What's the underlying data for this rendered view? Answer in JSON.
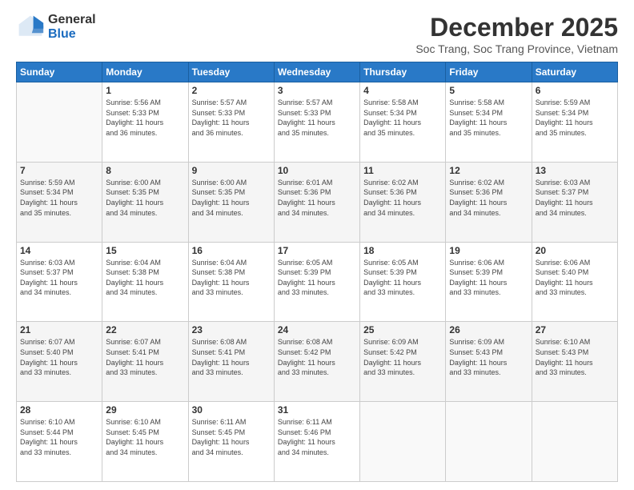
{
  "logo": {
    "general": "General",
    "blue": "Blue"
  },
  "title": "December 2025",
  "location": "Soc Trang, Soc Trang Province, Vietnam",
  "headers": [
    "Sunday",
    "Monday",
    "Tuesday",
    "Wednesday",
    "Thursday",
    "Friday",
    "Saturday"
  ],
  "weeks": [
    [
      {
        "day": "",
        "info": ""
      },
      {
        "day": "1",
        "info": "Sunrise: 5:56 AM\nSunset: 5:33 PM\nDaylight: 11 hours\nand 36 minutes."
      },
      {
        "day": "2",
        "info": "Sunrise: 5:57 AM\nSunset: 5:33 PM\nDaylight: 11 hours\nand 36 minutes."
      },
      {
        "day": "3",
        "info": "Sunrise: 5:57 AM\nSunset: 5:33 PM\nDaylight: 11 hours\nand 35 minutes."
      },
      {
        "day": "4",
        "info": "Sunrise: 5:58 AM\nSunset: 5:34 PM\nDaylight: 11 hours\nand 35 minutes."
      },
      {
        "day": "5",
        "info": "Sunrise: 5:58 AM\nSunset: 5:34 PM\nDaylight: 11 hours\nand 35 minutes."
      },
      {
        "day": "6",
        "info": "Sunrise: 5:59 AM\nSunset: 5:34 PM\nDaylight: 11 hours\nand 35 minutes."
      }
    ],
    [
      {
        "day": "7",
        "info": "Sunrise: 5:59 AM\nSunset: 5:34 PM\nDaylight: 11 hours\nand 35 minutes."
      },
      {
        "day": "8",
        "info": "Sunrise: 6:00 AM\nSunset: 5:35 PM\nDaylight: 11 hours\nand 34 minutes."
      },
      {
        "day": "9",
        "info": "Sunrise: 6:00 AM\nSunset: 5:35 PM\nDaylight: 11 hours\nand 34 minutes."
      },
      {
        "day": "10",
        "info": "Sunrise: 6:01 AM\nSunset: 5:36 PM\nDaylight: 11 hours\nand 34 minutes."
      },
      {
        "day": "11",
        "info": "Sunrise: 6:02 AM\nSunset: 5:36 PM\nDaylight: 11 hours\nand 34 minutes."
      },
      {
        "day": "12",
        "info": "Sunrise: 6:02 AM\nSunset: 5:36 PM\nDaylight: 11 hours\nand 34 minutes."
      },
      {
        "day": "13",
        "info": "Sunrise: 6:03 AM\nSunset: 5:37 PM\nDaylight: 11 hours\nand 34 minutes."
      }
    ],
    [
      {
        "day": "14",
        "info": "Sunrise: 6:03 AM\nSunset: 5:37 PM\nDaylight: 11 hours\nand 34 minutes."
      },
      {
        "day": "15",
        "info": "Sunrise: 6:04 AM\nSunset: 5:38 PM\nDaylight: 11 hours\nand 34 minutes."
      },
      {
        "day": "16",
        "info": "Sunrise: 6:04 AM\nSunset: 5:38 PM\nDaylight: 11 hours\nand 33 minutes."
      },
      {
        "day": "17",
        "info": "Sunrise: 6:05 AM\nSunset: 5:39 PM\nDaylight: 11 hours\nand 33 minutes."
      },
      {
        "day": "18",
        "info": "Sunrise: 6:05 AM\nSunset: 5:39 PM\nDaylight: 11 hours\nand 33 minutes."
      },
      {
        "day": "19",
        "info": "Sunrise: 6:06 AM\nSunset: 5:39 PM\nDaylight: 11 hours\nand 33 minutes."
      },
      {
        "day": "20",
        "info": "Sunrise: 6:06 AM\nSunset: 5:40 PM\nDaylight: 11 hours\nand 33 minutes."
      }
    ],
    [
      {
        "day": "21",
        "info": "Sunrise: 6:07 AM\nSunset: 5:40 PM\nDaylight: 11 hours\nand 33 minutes."
      },
      {
        "day": "22",
        "info": "Sunrise: 6:07 AM\nSunset: 5:41 PM\nDaylight: 11 hours\nand 33 minutes."
      },
      {
        "day": "23",
        "info": "Sunrise: 6:08 AM\nSunset: 5:41 PM\nDaylight: 11 hours\nand 33 minutes."
      },
      {
        "day": "24",
        "info": "Sunrise: 6:08 AM\nSunset: 5:42 PM\nDaylight: 11 hours\nand 33 minutes."
      },
      {
        "day": "25",
        "info": "Sunrise: 6:09 AM\nSunset: 5:42 PM\nDaylight: 11 hours\nand 33 minutes."
      },
      {
        "day": "26",
        "info": "Sunrise: 6:09 AM\nSunset: 5:43 PM\nDaylight: 11 hours\nand 33 minutes."
      },
      {
        "day": "27",
        "info": "Sunrise: 6:10 AM\nSunset: 5:43 PM\nDaylight: 11 hours\nand 33 minutes."
      }
    ],
    [
      {
        "day": "28",
        "info": "Sunrise: 6:10 AM\nSunset: 5:44 PM\nDaylight: 11 hours\nand 33 minutes."
      },
      {
        "day": "29",
        "info": "Sunrise: 6:10 AM\nSunset: 5:45 PM\nDaylight: 11 hours\nand 34 minutes."
      },
      {
        "day": "30",
        "info": "Sunrise: 6:11 AM\nSunset: 5:45 PM\nDaylight: 11 hours\nand 34 minutes."
      },
      {
        "day": "31",
        "info": "Sunrise: 6:11 AM\nSunset: 5:46 PM\nDaylight: 11 hours\nand 34 minutes."
      },
      {
        "day": "",
        "info": ""
      },
      {
        "day": "",
        "info": ""
      },
      {
        "day": "",
        "info": ""
      }
    ]
  ]
}
